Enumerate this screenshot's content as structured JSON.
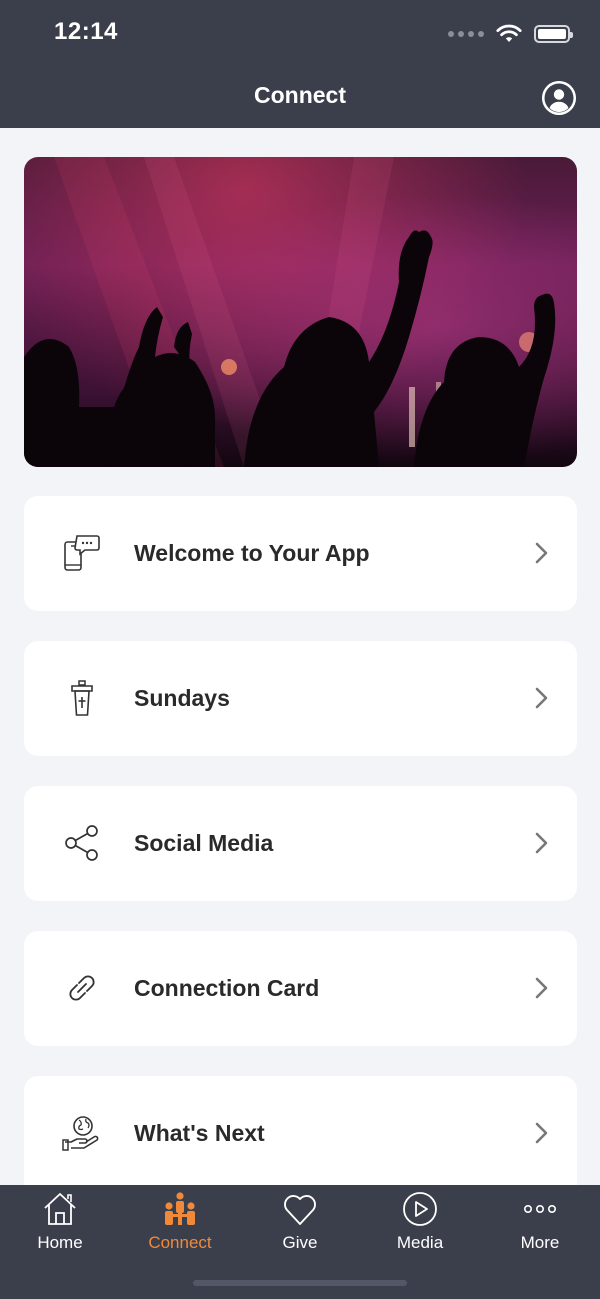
{
  "status_bar": {
    "time": "12:14"
  },
  "header": {
    "title": "Connect"
  },
  "menu": {
    "items": [
      {
        "label": "Welcome to Your App",
        "icon": "phone-chat-icon"
      },
      {
        "label": "Sundays",
        "icon": "pulpit-icon"
      },
      {
        "label": "Social Media",
        "icon": "share-icon"
      },
      {
        "label": "Connection Card",
        "icon": "link-icon"
      },
      {
        "label": "What's Next",
        "icon": "globe-hand-icon"
      }
    ]
  },
  "tabbar": {
    "tabs": [
      {
        "label": "Home",
        "icon": "home-icon"
      },
      {
        "label": "Connect",
        "icon": "people-icon",
        "active": true
      },
      {
        "label": "Give",
        "icon": "heart-icon"
      },
      {
        "label": "Media",
        "icon": "play-circle-icon"
      },
      {
        "label": "More",
        "icon": "more-dots-icon"
      }
    ]
  },
  "colors": {
    "bar": "#3b3f4c",
    "background": "#f3f4f8",
    "accent": "#f08a3a"
  }
}
